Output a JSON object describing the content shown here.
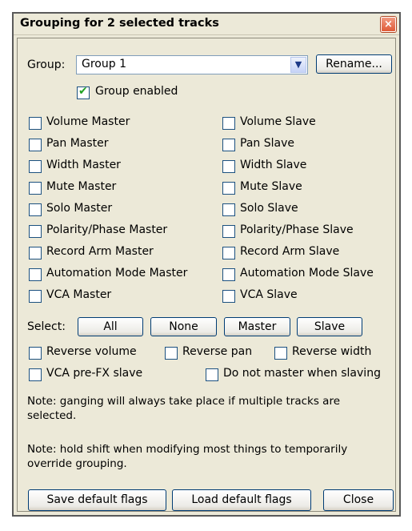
{
  "dialog": {
    "title": "Grouping for 2 selected tracks",
    "close_glyph": "×"
  },
  "group": {
    "label": "Group:",
    "selected": "Group 1",
    "rename_label": "Rename...",
    "enabled_label": "Group enabled",
    "enabled_checked": true
  },
  "flags": {
    "left": [
      {
        "label": "Volume Master",
        "checked": false
      },
      {
        "label": "Pan Master",
        "checked": false
      },
      {
        "label": "Width Master",
        "checked": false
      },
      {
        "label": "Mute Master",
        "checked": false
      },
      {
        "label": "Solo Master",
        "checked": false
      },
      {
        "label": "Polarity/Phase Master",
        "checked": false
      },
      {
        "label": "Record Arm Master",
        "checked": false
      },
      {
        "label": "Automation Mode Master",
        "checked": false
      },
      {
        "label": "VCA Master",
        "checked": false
      }
    ],
    "right": [
      {
        "label": "Volume Slave",
        "checked": false
      },
      {
        "label": "Pan Slave",
        "checked": false
      },
      {
        "label": "Width Slave",
        "checked": false
      },
      {
        "label": "Mute Slave",
        "checked": false
      },
      {
        "label": "Solo Slave",
        "checked": false
      },
      {
        "label": "Polarity/Phase Slave",
        "checked": false
      },
      {
        "label": "Record Arm Slave",
        "checked": false
      },
      {
        "label": "Automation Mode Slave",
        "checked": false
      },
      {
        "label": "VCA Slave",
        "checked": false
      }
    ]
  },
  "select_row": {
    "label": "Select:",
    "all": "All",
    "none": "None",
    "master": "Master",
    "slave": "Slave"
  },
  "options": {
    "reverse_volume": "Reverse volume",
    "reverse_pan": "Reverse pan",
    "reverse_width": "Reverse width",
    "vca_pre_fx": "VCA pre-FX slave",
    "no_master": "Do not master when slaving"
  },
  "notes": {
    "note1": "Note: ganging will always take place if multiple tracks are selected.",
    "note2": "Note: hold shift when modifying most things to temporarily override grouping."
  },
  "footer": {
    "save": "Save default flags",
    "load": "Load default flags",
    "close": "Close"
  }
}
